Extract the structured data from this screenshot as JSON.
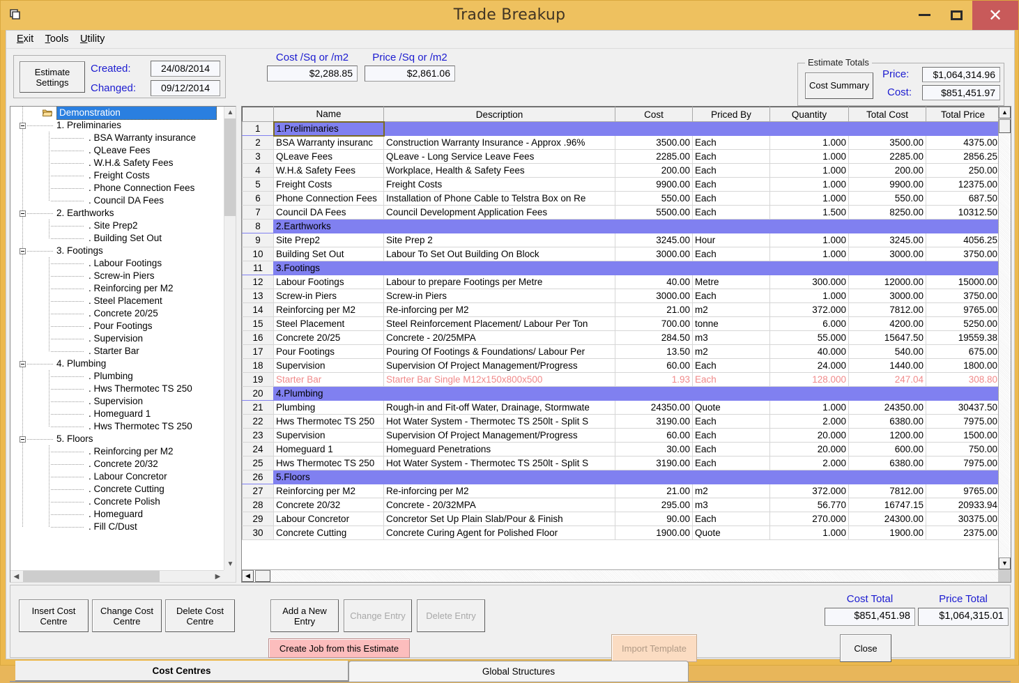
{
  "window": {
    "title": "Trade Breakup",
    "icon": "window-document-icon",
    "controls": {
      "minimize": "minimize-icon",
      "maximize": "maximize-icon",
      "close": "close-icon"
    },
    "close_color": "#c85a5a",
    "titlebar_color": "#eec15f"
  },
  "menu": {
    "items": [
      "Exit",
      "Tools",
      "Utility"
    ]
  },
  "toolbar": {
    "estimate_settings_box_legend": "",
    "estimate_settings_button": "Estimate\nSettings",
    "estimate_settings_line1": "Estimate",
    "estimate_settings_line2": "Settings",
    "created_label": "Created:",
    "created_value": "24/08/2014",
    "changed_label": "Changed:",
    "changed_value": "09/12/2014",
    "cost_sq_label": "Cost /Sq or /m2",
    "cost_sq_value": "$2,288.85",
    "price_sq_label": "Price /Sq or /m2",
    "price_sq_value": "$2,861.06"
  },
  "estimate_totals": {
    "legend": "Estimate Totals",
    "cost_summary_button": "Cost Summary",
    "price_label": "Price:",
    "price_value": "$1,064,314.96",
    "cost_label": "Cost:",
    "cost_value": "$851,451.97"
  },
  "tree": {
    "root": "Demonstration",
    "root_icon": "open-folder-icon",
    "nodes": [
      {
        "level": 1,
        "label": "1. Preliminaries"
      },
      {
        "level": 2,
        "label": ". BSA Warranty insurance"
      },
      {
        "level": 2,
        "label": ". QLeave Fees"
      },
      {
        "level": 2,
        "label": ". W.H.& Safety Fees"
      },
      {
        "level": 2,
        "label": ". Freight Costs"
      },
      {
        "level": 2,
        "label": ". Phone Connection Fees"
      },
      {
        "level": 2,
        "label": ". Council DA Fees"
      },
      {
        "level": 1,
        "label": "2. Earthworks"
      },
      {
        "level": 2,
        "label": ". Site Prep2"
      },
      {
        "level": 2,
        "label": ". Building Set Out"
      },
      {
        "level": 1,
        "label": "3. Footings"
      },
      {
        "level": 2,
        "label": ". Labour Footings"
      },
      {
        "level": 2,
        "label": ". Screw-in Piers"
      },
      {
        "level": 2,
        "label": ". Reinforcing per M2"
      },
      {
        "level": 2,
        "label": ". Steel Placement"
      },
      {
        "level": 2,
        "label": ". Concrete 20/25"
      },
      {
        "level": 2,
        "label": ". Pour Footings"
      },
      {
        "level": 2,
        "label": ". Supervision"
      },
      {
        "level": 2,
        "label": ". Starter Bar"
      },
      {
        "level": 1,
        "label": "4. Plumbing"
      },
      {
        "level": 2,
        "label": ". Plumbing"
      },
      {
        "level": 2,
        "label": ". Hws Thermotec TS 250"
      },
      {
        "level": 2,
        "label": ". Supervision"
      },
      {
        "level": 2,
        "label": ". Homeguard 1"
      },
      {
        "level": 2,
        "label": ". Hws Thermotec TS 250"
      },
      {
        "level": 1,
        "label": "5. Floors"
      },
      {
        "level": 2,
        "label": ". Reinforcing per M2"
      },
      {
        "level": 2,
        "label": ". Concrete 20/32"
      },
      {
        "level": 2,
        "label": ". Labour Concretor"
      },
      {
        "level": 2,
        "label": ". Concrete Cutting"
      },
      {
        "level": 2,
        "label": ". Concrete Polish"
      },
      {
        "level": 2,
        "label": ". Homeguard"
      },
      {
        "level": 2,
        "label": ". Fill C/Dust"
      }
    ]
  },
  "grid": {
    "columns": [
      "",
      "Name",
      "Description",
      "Cost",
      "Priced By",
      "Quantity",
      "Total Cost",
      "Total Price"
    ],
    "section_color": "#8080f0",
    "pink_color": "#f08a8a",
    "rows": [
      {
        "n": "1",
        "kind": "section",
        "selected": true,
        "name": "1.Preliminaries",
        "desc": "",
        "cost": "",
        "priced": "",
        "qty": "",
        "tcost": "",
        "tprice": ""
      },
      {
        "n": "2",
        "kind": "item",
        "name": "BSA Warranty insuranc",
        "desc": "Construction Warranty Insurance -  Approx .96%",
        "cost": "3500.00",
        "priced": "Each",
        "qty": "1.000",
        "tcost": "3500.00",
        "tprice": "4375.00"
      },
      {
        "n": "3",
        "kind": "item",
        "name": "QLeave Fees",
        "desc": "QLeave - Long Service Leave Fees",
        "cost": "2285.00",
        "priced": "Each",
        "qty": "1.000",
        "tcost": "2285.00",
        "tprice": "2856.25"
      },
      {
        "n": "4",
        "kind": "item",
        "name": "W.H.& Safety Fees",
        "desc": "Workplace, Health & Safety Fees",
        "cost": "200.00",
        "priced": "Each",
        "qty": "1.000",
        "tcost": "200.00",
        "tprice": "250.00"
      },
      {
        "n": "5",
        "kind": "item",
        "name": "Freight Costs",
        "desc": "Freight Costs",
        "cost": "9900.00",
        "priced": "Each",
        "qty": "1.000",
        "tcost": "9900.00",
        "tprice": "12375.00"
      },
      {
        "n": "6",
        "kind": "item",
        "name": "Phone Connection Fees",
        "desc": "Installation of Phone Cable to Telstra Box on Re",
        "cost": "550.00",
        "priced": "Each",
        "qty": "1.000",
        "tcost": "550.00",
        "tprice": "687.50"
      },
      {
        "n": "7",
        "kind": "item",
        "name": "Council DA Fees",
        "desc": "Council Development Application Fees",
        "cost": "5500.00",
        "priced": "Each",
        "qty": "1.500",
        "tcost": "8250.00",
        "tprice": "10312.50"
      },
      {
        "n": "8",
        "kind": "section",
        "name": "2.Earthworks",
        "desc": "",
        "cost": "",
        "priced": "",
        "qty": "",
        "tcost": "",
        "tprice": ""
      },
      {
        "n": "9",
        "kind": "item",
        "name": "Site Prep2",
        "desc": "Site Prep 2",
        "cost": "3245.00",
        "priced": "Hour",
        "qty": "1.000",
        "tcost": "3245.00",
        "tprice": "4056.25"
      },
      {
        "n": "10",
        "kind": "item",
        "name": "Building Set Out",
        "desc": "Labour To Set Out Building On Block",
        "cost": "3000.00",
        "priced": "Each",
        "qty": "1.000",
        "tcost": "3000.00",
        "tprice": "3750.00"
      },
      {
        "n": "11",
        "kind": "section",
        "name": "3.Footings",
        "desc": "",
        "cost": "",
        "priced": "",
        "qty": "",
        "tcost": "",
        "tprice": ""
      },
      {
        "n": "12",
        "kind": "item",
        "name": "Labour Footings",
        "desc": "Labour to prepare Footings per Metre",
        "cost": "40.00",
        "priced": "Metre",
        "qty": "300.000",
        "tcost": "12000.00",
        "tprice": "15000.00"
      },
      {
        "n": "13",
        "kind": "item",
        "name": "Screw-in Piers",
        "desc": "Screw-in Piers",
        "cost": "3000.00",
        "priced": "Each",
        "qty": "1.000",
        "tcost": "3000.00",
        "tprice": "3750.00"
      },
      {
        "n": "14",
        "kind": "item",
        "name": "Reinforcing per M2",
        "desc": "Re-inforcing per M2",
        "cost": "21.00",
        "priced": "m2",
        "qty": "372.000",
        "tcost": "7812.00",
        "tprice": "9765.00"
      },
      {
        "n": "15",
        "kind": "item",
        "name": "Steel Placement",
        "desc": "Steel Reinforcement Placement/ Labour Per Ton",
        "cost": "700.00",
        "priced": "tonne",
        "qty": "6.000",
        "tcost": "4200.00",
        "tprice": "5250.00"
      },
      {
        "n": "16",
        "kind": "item",
        "name": "Concrete 20/25",
        "desc": "Concrete - 20/25MPA",
        "cost": "284.50",
        "priced": "m3",
        "qty": "55.000",
        "tcost": "15647.50",
        "tprice": "19559.38"
      },
      {
        "n": "17",
        "kind": "item",
        "name": "Pour Footings",
        "desc": "Pouring Of Footings & Foundations/ Labour Per",
        "cost": "13.50",
        "priced": "m2",
        "qty": "40.000",
        "tcost": "540.00",
        "tprice": "675.00"
      },
      {
        "n": "18",
        "kind": "item",
        "name": "Supervision",
        "desc": "Supervision Of Project Management/Progress",
        "cost": "60.00",
        "priced": "Each",
        "qty": "24.000",
        "tcost": "1440.00",
        "tprice": "1800.00"
      },
      {
        "n": "19",
        "kind": "pink",
        "name": "Starter Bar",
        "desc": "Starter Bar Single M12x150x800x500",
        "cost": "1.93",
        "priced": "Each",
        "qty": "128.000",
        "tcost": "247.04",
        "tprice": "308.80"
      },
      {
        "n": "20",
        "kind": "section",
        "name": "4.Plumbing",
        "desc": "",
        "cost": "",
        "priced": "",
        "qty": "",
        "tcost": "",
        "tprice": ""
      },
      {
        "n": "21",
        "kind": "item",
        "name": "Plumbing",
        "desc": "Rough-in and Fit-off Water, Drainage, Stormwate",
        "cost": "24350.00",
        "priced": "Quote",
        "qty": "1.000",
        "tcost": "24350.00",
        "tprice": "30437.50"
      },
      {
        "n": "22",
        "kind": "item",
        "name": "Hws Thermotec TS 250",
        "desc": "Hot Water System - Thermotec TS 250lt - Split S",
        "cost": "3190.00",
        "priced": "Each",
        "qty": "2.000",
        "tcost": "6380.00",
        "tprice": "7975.00"
      },
      {
        "n": "23",
        "kind": "item",
        "name": "Supervision",
        "desc": "Supervision Of Project Management/Progress",
        "cost": "60.00",
        "priced": "Each",
        "qty": "20.000",
        "tcost": "1200.00",
        "tprice": "1500.00"
      },
      {
        "n": "24",
        "kind": "item",
        "name": "Homeguard 1",
        "desc": "Homeguard Penetrations",
        "cost": "30.00",
        "priced": "Each",
        "qty": "20.000",
        "tcost": "600.00",
        "tprice": "750.00"
      },
      {
        "n": "25",
        "kind": "item",
        "name": "Hws Thermotec TS 250",
        "desc": "Hot Water System - Thermotec TS 250lt - Split S",
        "cost": "3190.00",
        "priced": "Each",
        "qty": "2.000",
        "tcost": "6380.00",
        "tprice": "7975.00"
      },
      {
        "n": "26",
        "kind": "section",
        "name": "5.Floors",
        "desc": "",
        "cost": "",
        "priced": "",
        "qty": "",
        "tcost": "",
        "tprice": ""
      },
      {
        "n": "27",
        "kind": "item",
        "name": "Reinforcing per M2",
        "desc": "Re-inforcing per M2",
        "cost": "21.00",
        "priced": "m2",
        "qty": "372.000",
        "tcost": "7812.00",
        "tprice": "9765.00"
      },
      {
        "n": "28",
        "kind": "item",
        "name": "Concrete 20/32",
        "desc": "Concrete - 20/32MPA",
        "cost": "295.00",
        "priced": "m3",
        "qty": "56.770",
        "tcost": "16747.15",
        "tprice": "20933.94"
      },
      {
        "n": "29",
        "kind": "item",
        "name": "Labour Concretor",
        "desc": "Concretor Set Up Plain Slab/Pour & Finish",
        "cost": "90.00",
        "priced": "Each",
        "qty": "270.000",
        "tcost": "24300.00",
        "tprice": "30375.00"
      },
      {
        "n": "30",
        "kind": "item",
        "name": "Concrete Cutting",
        "desc": "Concrete Curing Agent for Polished Floor",
        "cost": "1900.00",
        "priced": "Quote",
        "qty": "1.000",
        "tcost": "1900.00",
        "tprice": "2375.00"
      }
    ]
  },
  "bottom": {
    "insert_cost_centre_l1": "Insert Cost",
    "insert_cost_centre_l2": "Centre",
    "change_cost_centre_l1": "Change Cost",
    "change_cost_centre_l2": "Centre",
    "delete_cost_centre_l1": "Delete Cost",
    "delete_cost_centre_l2": "Centre",
    "add_new_entry_l1": "Add a New",
    "add_new_entry_l2": "Entry",
    "change_entry": "Change Entry",
    "delete_entry": "Delete Entry",
    "create_job": "Create Job from this Estimate",
    "import_template": "Import Template",
    "close": "Close",
    "cost_total_label": "Cost Total",
    "cost_total_value": "$851,451.98",
    "price_total_label": "Price Total",
    "price_total_value": "$1,064,315.01",
    "create_job_color": "#fcbdbd",
    "import_template_color": "#fbdcc2"
  },
  "tabs": {
    "active": "Cost Centres",
    "items": [
      "Cost Centres",
      "Global Structures"
    ]
  }
}
